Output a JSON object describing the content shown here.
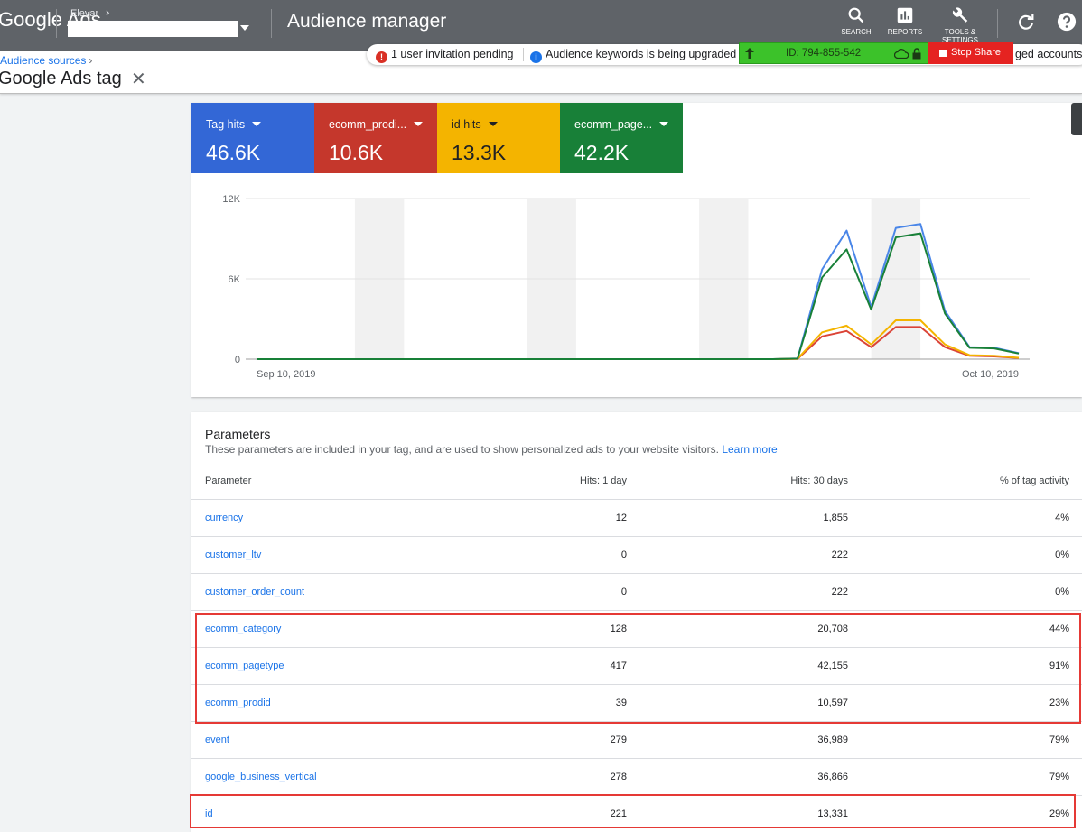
{
  "header": {
    "brand": "Google Ads",
    "account_label": "Elevar",
    "account_chevron": "›",
    "title": "Audience manager",
    "actions": [
      {
        "label": "SEARCH",
        "icon": "search-icon"
      },
      {
        "label": "REPORTS",
        "icon": "reports-icon"
      },
      {
        "label": "TOOLS & SETTINGS",
        "icon": "wrench-icon"
      }
    ],
    "refresh_icon": "refresh-icon",
    "help_icon": "help-icon"
  },
  "notifications": {
    "invite_text": "1 user invitation pending",
    "keywords_text": "Audience keywords is being upgraded",
    "accounts_text": "ged accounts"
  },
  "screen_share": {
    "id_text": "ID: 794-855-542",
    "stop_label": "Stop Share"
  },
  "breadcrumb": {
    "parent": "Audience sources",
    "chevron": "›"
  },
  "page_title": "Google Ads tag",
  "close_glyph": "✕",
  "metrics": [
    {
      "label": "Tag hits",
      "value": "46.6K",
      "color": "#3367d6"
    },
    {
      "label": "ecomm_prodi...",
      "value": "10.6K",
      "color": "#c5372c"
    },
    {
      "label": "id hits",
      "value": "13.3K",
      "color": "#f4b400"
    },
    {
      "label": "ecomm_page...",
      "value": "42.2K",
      "color": "#188038"
    }
  ],
  "chart_data": {
    "type": "line",
    "x_start": "Sep 10, 2019",
    "x_end": "Oct 10, 2019",
    "ylim": [
      0,
      12000
    ],
    "y_ticks": [
      "12K",
      "6K",
      "0"
    ],
    "y_tick_values": [
      12000,
      6000,
      0
    ],
    "weekend_bands": [
      [
        4,
        6
      ],
      [
        11,
        13
      ],
      [
        18,
        20
      ],
      [
        25,
        27
      ]
    ],
    "series": [
      {
        "name": "Tag hits",
        "color": "#4a86e8",
        "values": [
          0,
          0,
          0,
          0,
          0,
          0,
          0,
          0,
          0,
          0,
          0,
          0,
          0,
          0,
          0,
          0,
          0,
          0,
          0,
          0,
          0,
          0,
          50,
          6700,
          9600,
          3900,
          9800,
          10100,
          3600,
          900,
          850,
          450
        ]
      },
      {
        "name": "ecomm_prodi...",
        "color": "#db4437",
        "values": [
          0,
          0,
          0,
          0,
          0,
          0,
          0,
          0,
          0,
          0,
          0,
          0,
          0,
          0,
          0,
          0,
          0,
          0,
          0,
          0,
          0,
          0,
          20,
          1700,
          2100,
          900,
          2400,
          2400,
          900,
          250,
          200,
          80
        ]
      },
      {
        "name": "id hits",
        "color": "#f4b400",
        "values": [
          0,
          0,
          0,
          0,
          0,
          0,
          0,
          0,
          0,
          0,
          0,
          0,
          0,
          0,
          0,
          0,
          0,
          0,
          0,
          0,
          0,
          0,
          30,
          2000,
          2500,
          1100,
          2900,
          2900,
          1100,
          300,
          250,
          100
        ]
      },
      {
        "name": "ecomm_page...",
        "color": "#188038",
        "values": [
          0,
          0,
          0,
          0,
          0,
          0,
          0,
          0,
          0,
          0,
          0,
          0,
          0,
          0,
          0,
          0,
          0,
          0,
          0,
          0,
          0,
          0,
          40,
          6100,
          8200,
          3700,
          9100,
          9400,
          3400,
          850,
          800,
          420
        ]
      }
    ]
  },
  "params": {
    "title": "Parameters",
    "description": "These parameters are included in your tag, and are used to show personalized ads to your website visitors.",
    "learn_more": "Learn more",
    "columns": [
      "Parameter",
      "Hits: 1 day",
      "Hits: 30 days",
      "% of tag activity"
    ],
    "rows": [
      {
        "name": "currency",
        "hits1": "12",
        "hits30": "1,855",
        "pct": "4%"
      },
      {
        "name": "customer_ltv",
        "hits1": "0",
        "hits30": "222",
        "pct": "0%"
      },
      {
        "name": "customer_order_count",
        "hits1": "0",
        "hits30": "222",
        "pct": "0%"
      },
      {
        "name": "ecomm_category",
        "hits1": "128",
        "hits30": "20,708",
        "pct": "44%"
      },
      {
        "name": "ecomm_pagetype",
        "hits1": "417",
        "hits30": "42,155",
        "pct": "91%"
      },
      {
        "name": "ecomm_prodid",
        "hits1": "39",
        "hits30": "10,597",
        "pct": "23%"
      },
      {
        "name": "event",
        "hits1": "279",
        "hits30": "36,989",
        "pct": "79%"
      },
      {
        "name": "google_business_vertical",
        "hits1": "278",
        "hits30": "36,866",
        "pct": "79%"
      },
      {
        "name": "id",
        "hits1": "221",
        "hits30": "13,331",
        "pct": "29%"
      }
    ]
  },
  "highlight_color": "#e53935"
}
